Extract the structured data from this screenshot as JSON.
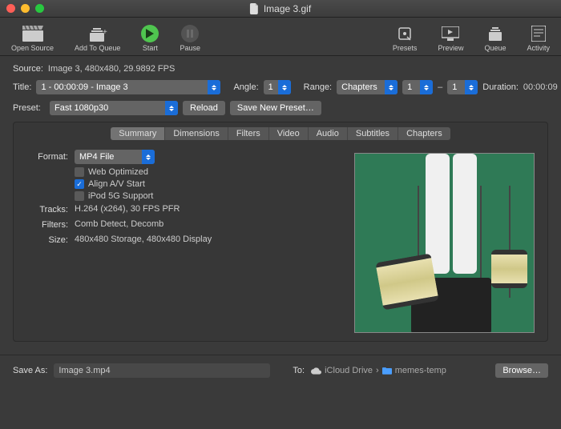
{
  "window": {
    "title": "Image 3.gif"
  },
  "toolbar": {
    "open": "Open Source",
    "addq": "Add To Queue",
    "start": "Start",
    "pause": "Pause",
    "presets": "Presets",
    "preview": "Preview",
    "queue": "Queue",
    "activity": "Activity"
  },
  "source": {
    "label": "Source:",
    "value": "Image 3, 480x480, 29.9892 FPS"
  },
  "title": {
    "label": "Title:",
    "value": "1 - 00:00:09 - Image 3"
  },
  "angle": {
    "label": "Angle:",
    "value": "1"
  },
  "range": {
    "label": "Range:",
    "value": "Chapters",
    "from": "1",
    "sep": "–",
    "to": "1"
  },
  "duration": {
    "label": "Duration:",
    "value": "00:00:09"
  },
  "preset": {
    "label": "Preset:",
    "value": "Fast 1080p30",
    "reload": "Reload",
    "savenew": "Save New Preset…"
  },
  "tabs": {
    "summary": "Summary",
    "dimensions": "Dimensions",
    "filters": "Filters",
    "video": "Video",
    "audio": "Audio",
    "subtitles": "Subtitles",
    "chapters": "Chapters"
  },
  "summary": {
    "format_label": "Format:",
    "format_value": "MP4 File",
    "web_opt": "Web Optimized",
    "align_av": "Align A/V Start",
    "ipod": "iPod 5G Support",
    "tracks_label": "Tracks:",
    "tracks_value": "H.264 (x264), 30 FPS PFR",
    "filters_label": "Filters:",
    "filters_value": "Comb Detect, Decomb",
    "size_label": "Size:",
    "size_value": "480x480 Storage, 480x480 Display"
  },
  "save": {
    "label": "Save As:",
    "value": "Image 3.mp4",
    "to": "To:",
    "loc1": "iCloud Drive",
    "loc2": "memes-temp",
    "browse": "Browse…"
  }
}
